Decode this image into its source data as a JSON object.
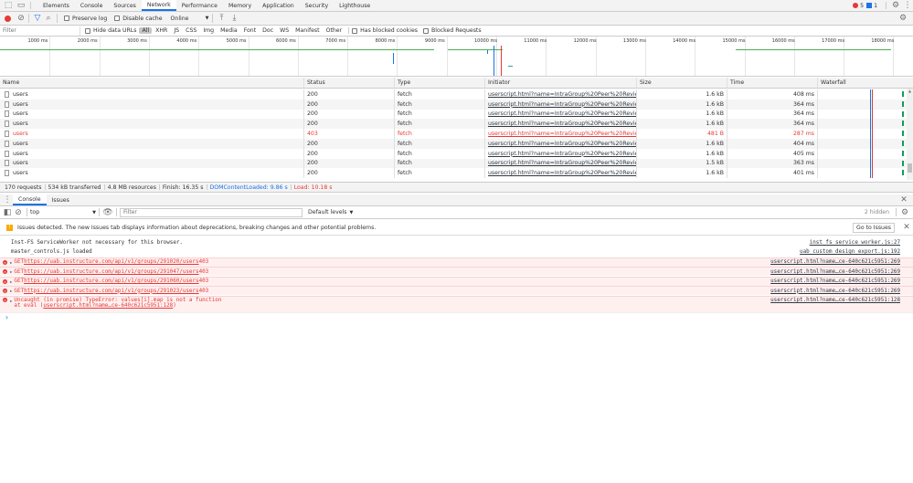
{
  "tabs": [
    "Elements",
    "Console",
    "Sources",
    "Network",
    "Performance",
    "Memory",
    "Application",
    "Security",
    "Lighthouse"
  ],
  "badges": {
    "errors": "5",
    "messages": "1"
  },
  "toolbar": {
    "preserve_log": "Preserve log",
    "disable_cache": "Disable cache",
    "throttle": "Online"
  },
  "filterbar": {
    "placeholder": "Filter",
    "hide_data_urls": "Hide data URLs",
    "types": [
      "All",
      "XHR",
      "JS",
      "CSS",
      "Img",
      "Media",
      "Font",
      "Doc",
      "WS",
      "Manifest",
      "Other"
    ],
    "blocked_cookies": "Has blocked cookies",
    "blocked_requests": "Blocked Requests"
  },
  "timeline": {
    "ticks": [
      "1000 ms",
      "2000 ms",
      "3000 ms",
      "4000 ms",
      "5000 ms",
      "6000 ms",
      "7000 ms",
      "8000 ms",
      "9000 ms",
      "10000 ms",
      "11000 ms",
      "12000 ms",
      "13000 ms",
      "14000 ms",
      "15000 ms",
      "16000 ms",
      "17000 ms",
      "18000 ms"
    ]
  },
  "table": {
    "headers": {
      "name": "Name",
      "status": "Status",
      "type": "Type",
      "initiator": "Initiator",
      "size": "Size",
      "time": "Time",
      "waterfall": "Waterfall"
    },
    "rows": [
      {
        "name": "users",
        "status": "200",
        "type": "fetch",
        "initiator": "userscript.html?name=IntraGroup%20Peer%20Reviews.u...",
        "size": "1.6 kB",
        "time": "408 ms",
        "error": false
      },
      {
        "name": "users",
        "status": "200",
        "type": "fetch",
        "initiator": "userscript.html?name=IntraGroup%20Peer%20Reviews.u...",
        "size": "1.6 kB",
        "time": "364 ms",
        "error": false
      },
      {
        "name": "users",
        "status": "200",
        "type": "fetch",
        "initiator": "userscript.html?name=IntraGroup%20Peer%20Reviews.u...",
        "size": "1.6 kB",
        "time": "364 ms",
        "error": false
      },
      {
        "name": "users",
        "status": "200",
        "type": "fetch",
        "initiator": "userscript.html?name=IntraGroup%20Peer%20Reviews.u...",
        "size": "1.6 kB",
        "time": "364 ms",
        "error": false
      },
      {
        "name": "users",
        "status": "403",
        "type": "fetch",
        "initiator": "userscript.html?name=IntraGroup%20Peer%20Reviews.u...",
        "size": "481 B",
        "time": "287 ms",
        "error": true
      },
      {
        "name": "users",
        "status": "200",
        "type": "fetch",
        "initiator": "userscript.html?name=IntraGroup%20Peer%20Reviews.u...",
        "size": "1.6 kB",
        "time": "404 ms",
        "error": false
      },
      {
        "name": "users",
        "status": "200",
        "type": "fetch",
        "initiator": "userscript.html?name=IntraGroup%20Peer%20Reviews.u...",
        "size": "1.6 kB",
        "time": "405 ms",
        "error": false
      },
      {
        "name": "users",
        "status": "200",
        "type": "fetch",
        "initiator": "userscript.html?name=IntraGroup%20Peer%20Reviews.u...",
        "size": "1.5 kB",
        "time": "363 ms",
        "error": false
      },
      {
        "name": "users",
        "status": "200",
        "type": "fetch",
        "initiator": "userscript.html?name=IntraGroup%20Peer%20Reviews.u...",
        "size": "1.6 kB",
        "time": "401 ms",
        "error": false
      }
    ]
  },
  "summary": {
    "requests": "170 requests",
    "transferred": "534 kB transferred",
    "resources": "4.8 MB resources",
    "finish": "Finish: 16.35 s",
    "dcl": "DOMContentLoaded: 9.86 s",
    "load": "Load: 10.18 s"
  },
  "drawer": {
    "tabs": [
      "Console",
      "Issues"
    ],
    "context": "top",
    "filter_placeholder": "Filter",
    "levels": "Default levels",
    "hidden": "2 hidden"
  },
  "issues": {
    "text": "Issues detected. The new Issues tab displays information about deprecations, breaking changes and other potential problems.",
    "button": "Go to Issues"
  },
  "console": [
    {
      "msg": "Inst-FS ServiceWorker not necessary for this browser.",
      "src": "inst_fs_service_worker.js:27",
      "error": false
    },
    {
      "msg": "master_controls.js loaded",
      "src": "uab_custom_design_export.js:192",
      "error": false
    },
    {
      "prefix": "GET ",
      "url": "https://uab.instructure.com/api/v1/groups/291020/users",
      "code": " 403",
      "src": "userscript.html?name…ce-640c621c5951:269",
      "error": true
    },
    {
      "prefix": "GET ",
      "url": "https://uab.instructure.com/api/v1/groups/291047/users",
      "code": " 403",
      "src": "userscript.html?name…ce-640c621c5951:269",
      "error": true
    },
    {
      "prefix": "GET ",
      "url": "https://uab.instructure.com/api/v1/groups/291060/users",
      "code": " 403",
      "src": "userscript.html?name…ce-640c621c5951:269",
      "error": true
    },
    {
      "prefix": "GET ",
      "url": "https://uab.instructure.com/api/v1/groups/291023/users",
      "code": " 403",
      "src": "userscript.html?name…ce-640c621c5951:269",
      "error": true
    }
  ],
  "uncaught": {
    "msg": "Uncaught (in promise) TypeError: values[i].map is not a function",
    "at": "    at eval (",
    "at_link": "userscript.html?name…ce-640c621c5951:128",
    "at_end": ")",
    "src": "userscript.html?name…ce-640c621c5951:128"
  },
  "prompt": "›"
}
